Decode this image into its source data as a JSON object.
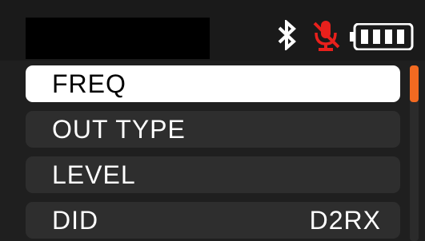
{
  "status": {
    "icons": {
      "bluetooth": "bluetooth-icon",
      "microphone": "microphone-muted-icon",
      "battery": "battery-full-icon"
    },
    "mic_color": "#e8201c",
    "battery_color": "#ffffff"
  },
  "menu": {
    "items": [
      {
        "label": "FREQ",
        "value": "",
        "selected": true
      },
      {
        "label": "OUT TYPE",
        "value": ""
      },
      {
        "label": "LEVEL",
        "value": ""
      },
      {
        "label": "DID",
        "value": "D2RX"
      }
    ]
  },
  "scrollbar": {
    "thumb_color": "#f26a21"
  }
}
